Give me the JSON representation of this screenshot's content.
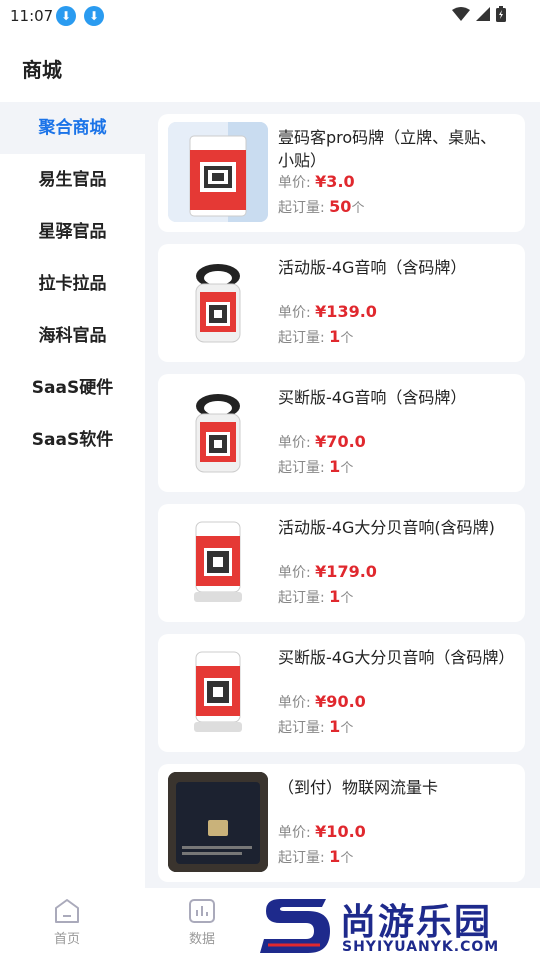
{
  "status_bar": {
    "time": "11:07"
  },
  "header": {
    "title": "商城"
  },
  "sidebar": {
    "items": [
      {
        "label": "聚合商城",
        "active": true
      },
      {
        "label": "易生官品"
      },
      {
        "label": "星驿官品"
      },
      {
        "label": "拉卡拉品"
      },
      {
        "label": "海科官品"
      },
      {
        "label": "SaaS硬件"
      },
      {
        "label": "SaaS软件"
      }
    ]
  },
  "labels": {
    "price_label": "单价:",
    "moq_label": "起订量:",
    "unit": "个"
  },
  "products": [
    {
      "name": "壹码客pro码牌（立牌、桌贴、小贴）",
      "price": "¥3.0",
      "moq": "50"
    },
    {
      "name": "活动版-4G音响（含码牌）",
      "price": "¥139.0",
      "moq": "1"
    },
    {
      "name": "买断版-4G音响（含码牌）",
      "price": "¥70.0",
      "moq": "1"
    },
    {
      "name": "活动版-4G大分贝音响(含码牌)",
      "price": "¥179.0",
      "moq": "1"
    },
    {
      "name": "买断版-4G大分贝音响（含码牌）",
      "price": "¥90.0",
      "moq": "1"
    },
    {
      "name": "（到付）物联网流量卡",
      "price": "¥10.0",
      "moq": "1"
    }
  ],
  "tabbar": {
    "items": [
      {
        "label": "首页"
      },
      {
        "label": "数据"
      }
    ]
  },
  "watermark": {
    "title": "尚游乐园",
    "url": "SHYIYUANYK.COM"
  },
  "colors": {
    "accent": "#1a73e8",
    "price": "#e0282e",
    "panel_bg": "#f2f4f8"
  }
}
